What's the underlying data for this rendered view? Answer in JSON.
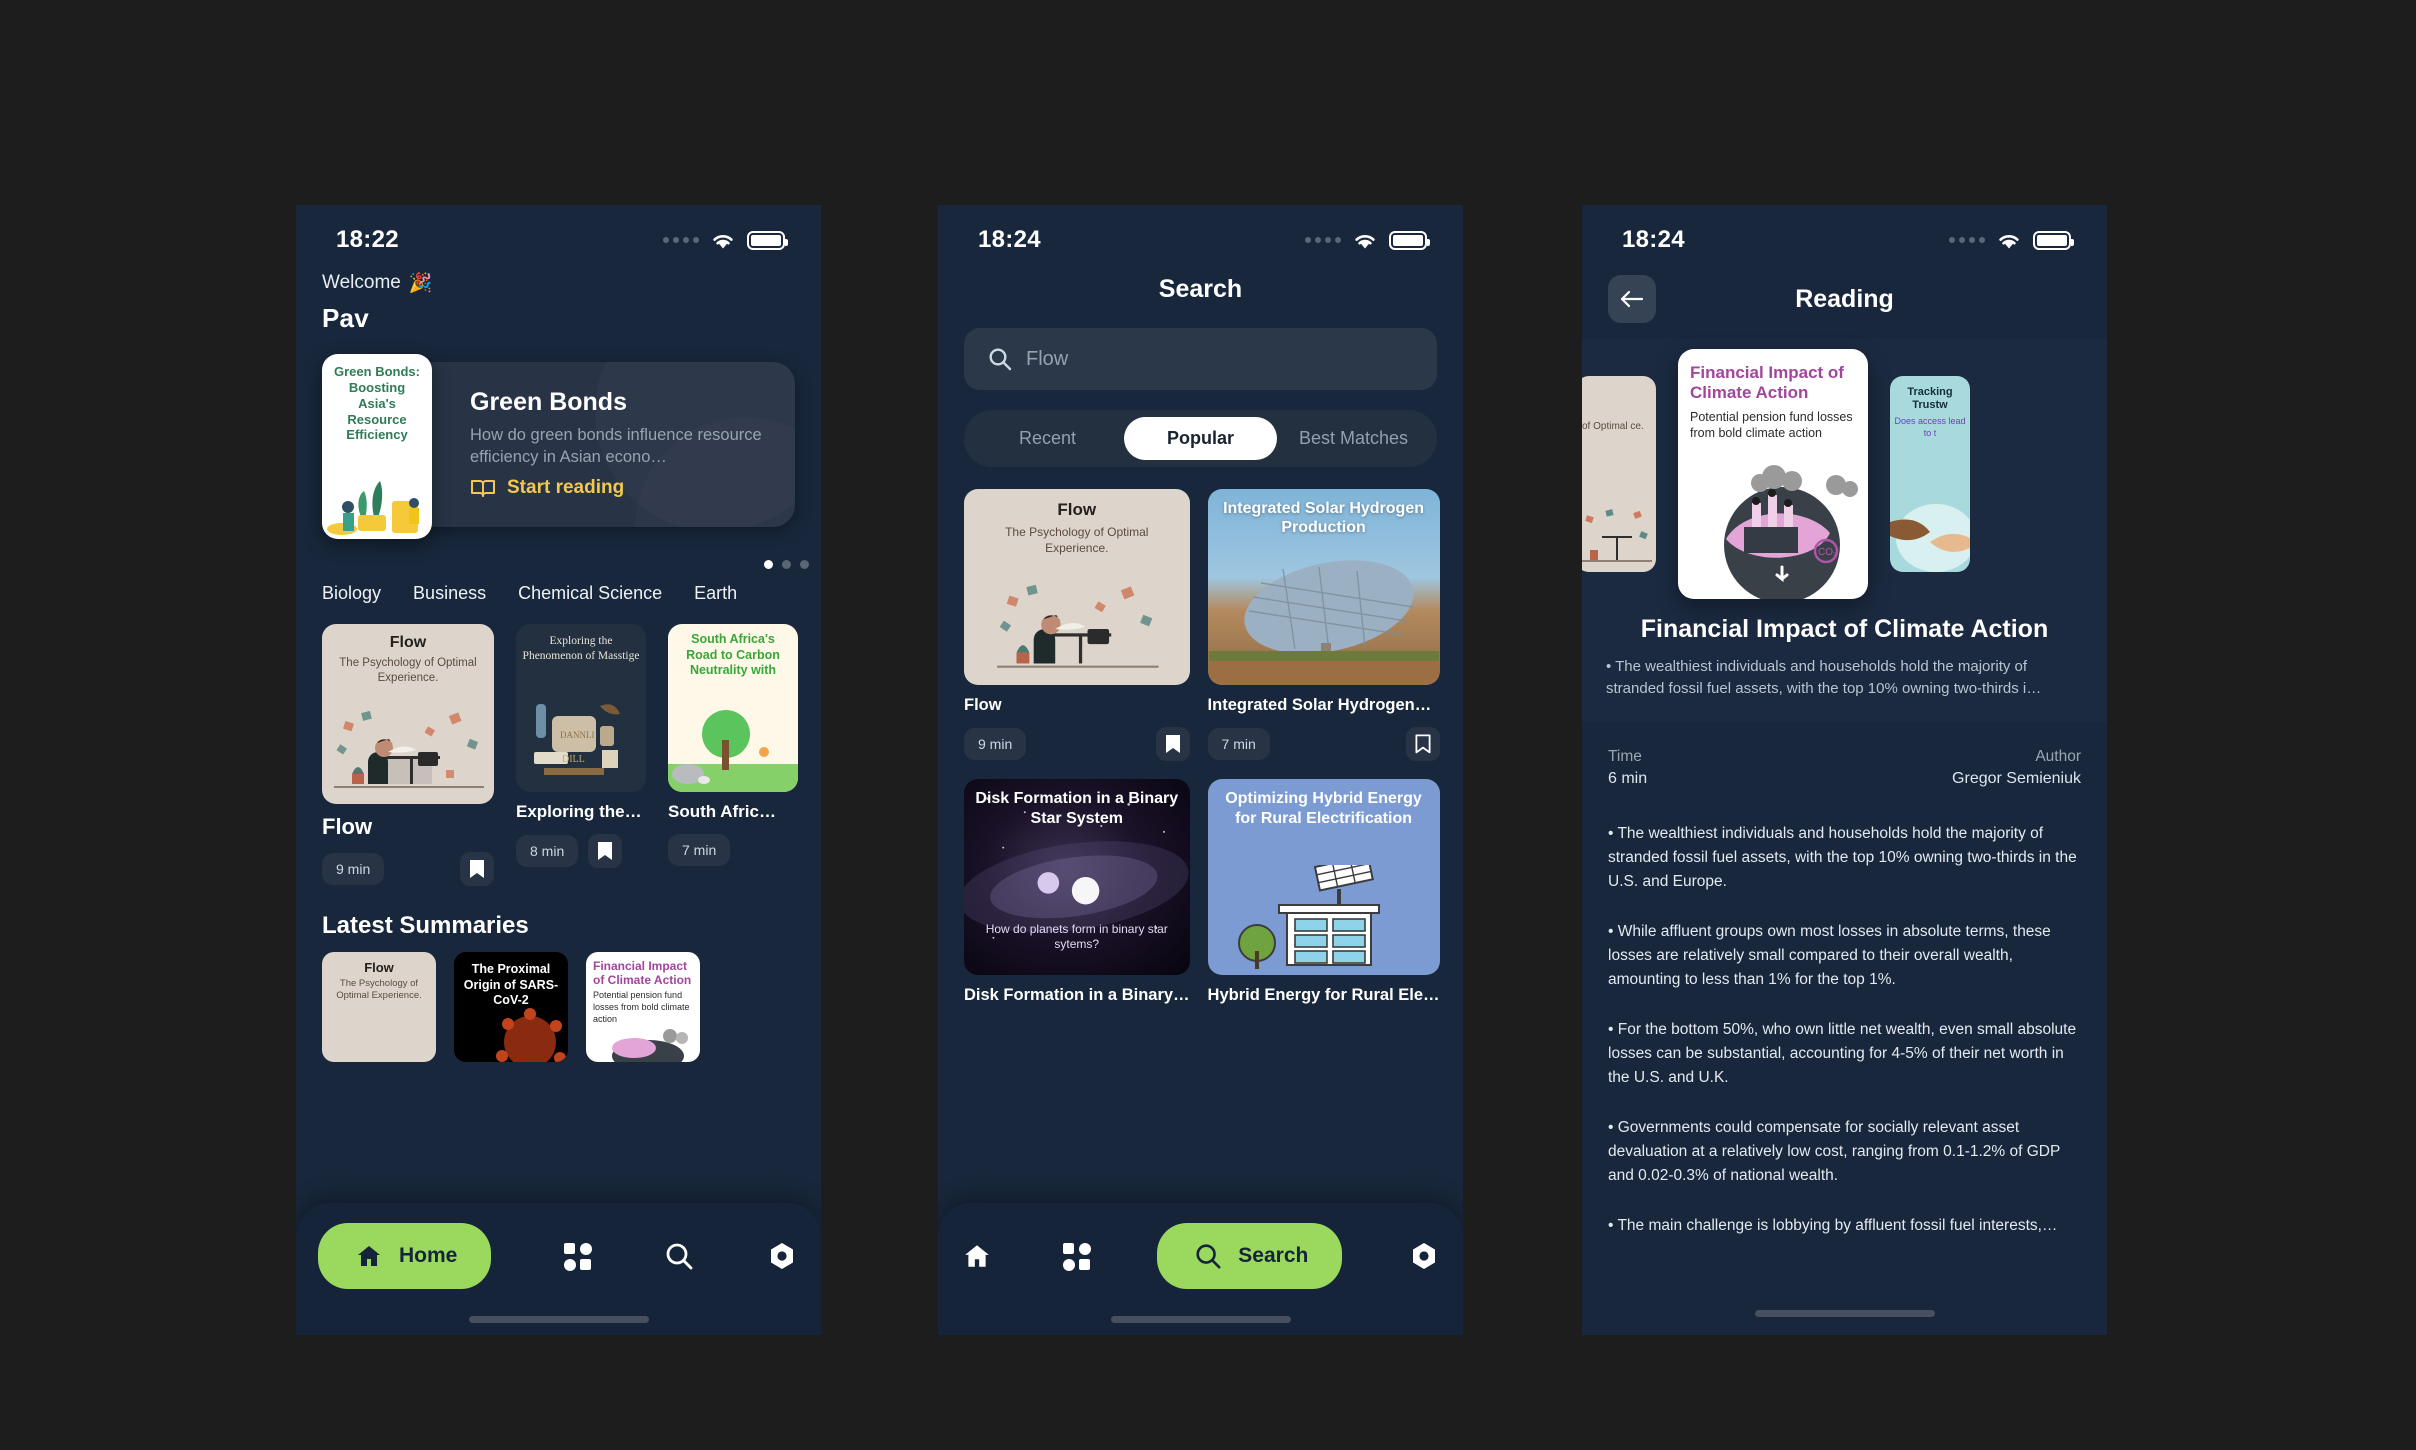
{
  "app": {
    "accent_green": "#9ad95e",
    "accent_yellow": "#f2c94c",
    "bg_dark": "#1d1d1d",
    "phone_bg": "#18273b"
  },
  "screen_home": {
    "status": {
      "time": "18:22",
      "wifi_icon": "wifi-icon",
      "battery_icon": "battery-icon"
    },
    "welcome_label": "Welcome",
    "welcome_emoji": "🎉",
    "user_name": "Pav",
    "hero": {
      "thumb_title": "Green Bonds: Boosting Asia's Resource Efficiency",
      "title": "Green Bonds",
      "description": "How do green bonds influence resource efficiency in Asian econo…",
      "cta_label": "Start reading",
      "cta_icon": "book-icon",
      "dots_total": 3,
      "dots_active": 1
    },
    "categories": [
      "Biology",
      "Business",
      "Chemical Science",
      "Earth"
    ],
    "cards": [
      {
        "name": "Flow",
        "cover_title": "Flow",
        "cover_sub": "The Psychology of Optimal Experience.",
        "time": "9 min",
        "bookmarked": true
      },
      {
        "name": "Exploring the Ph…",
        "cover_title": "Exploring the Phenomenon of Masstige",
        "time": "8 min",
        "bookmarked": true
      },
      {
        "name": "South Afric…",
        "cover_title": "South Africa's Road to Carbon Neutrality with",
        "time": "7 min",
        "bookmarked": true
      }
    ],
    "latest_title": "Latest Summaries",
    "latest": [
      {
        "title": "Flow",
        "sub": "The Psychology of Optimal Experience."
      },
      {
        "title": "The Proximal Origin of SARS-CoV-2",
        "sub": ""
      },
      {
        "title": "Financial Impact of Climate Action",
        "sub": "Potential pension fund losses from bold climate action"
      }
    ],
    "nav": {
      "active_label": "Home",
      "active_icon": "home-icon",
      "items": [
        "grid-icon",
        "search-icon",
        "settings-icon"
      ]
    }
  },
  "screen_search": {
    "status": {
      "time": "18:24",
      "wifi_icon": "wifi-icon",
      "battery_icon": "battery-icon"
    },
    "title": "Search",
    "search": {
      "value": "Flow",
      "placeholder": "Flow",
      "icon": "search-icon"
    },
    "segments": [
      "Recent",
      "Popular",
      "Best Matches"
    ],
    "segment_active": "Popular",
    "results": [
      {
        "name": "Flow",
        "cover_title": "Flow",
        "cover_sub": "The Psychology of Optimal Experience.",
        "time": "9 min",
        "bookmarked": true
      },
      {
        "name": "Integrated Solar Hydrogen…",
        "cover_title": "Integrated Solar Hydrogen Production",
        "time": "7 min",
        "bookmarked": false
      },
      {
        "name": "Disk Formation in a Binary…",
        "cover_title": "Disk Formation in a Binary Star System",
        "cover_sub": "How do planets form in binary star sytems?",
        "time": "",
        "bookmarked": true
      },
      {
        "name": "Hybrid Energy for Rural Ele…",
        "cover_title": "Optimizing Hybrid Energy for Rural Electrification",
        "time": "",
        "bookmarked": true
      }
    ],
    "nav": {
      "active_label": "Search",
      "active_icon": "search-icon",
      "items": [
        "home-icon",
        "grid-icon",
        "settings-icon"
      ]
    }
  },
  "screen_reading": {
    "status": {
      "time": "18:24",
      "wifi_icon": "wifi-icon",
      "battery_icon": "battery-icon"
    },
    "title": "Reading",
    "back_icon": "arrow-left-icon",
    "carousel": {
      "left": {
        "cover_sub": "of Optimal ce."
      },
      "center": {
        "title": "Financial Impact of Climate Action",
        "sub": "Potential pension fund losses from bold climate action"
      },
      "right": {
        "title": "Tracking Trustw",
        "sub": "Does access lead to t"
      }
    },
    "article_title": "Financial Impact of Climate Action",
    "excerpt": "• The wealthiest individuals and households hold the majority of stranded fossil fuel assets, with the top 10% owning two-thirds i…",
    "meta": {
      "time_label": "Time",
      "time_value": "6 min",
      "author_label": "Author",
      "author_value": "Gregor Semieniuk"
    },
    "body": [
      "• The wealthiest individuals and households hold the majority of stranded fossil fuel assets, with the top 10% owning two-thirds in the U.S. and Europe.",
      "• While affluent groups own most losses in absolute terms, these losses are relatively small compared to their overall wealth, amounting to less than 1% for the top 1%.",
      "• For the bottom 50%, who own little net wealth, even small absolute losses can be substantial, accounting for 4-5% of their net worth in the U.S. and U.K.",
      "• Governments could compensate for socially relevant asset devaluation at a relatively low cost, ranging from 0.1-1.2% of GDP and 0.02-0.3% of national wealth.",
      "• The main challenge is lobbying by affluent fossil fuel interests,…"
    ]
  }
}
